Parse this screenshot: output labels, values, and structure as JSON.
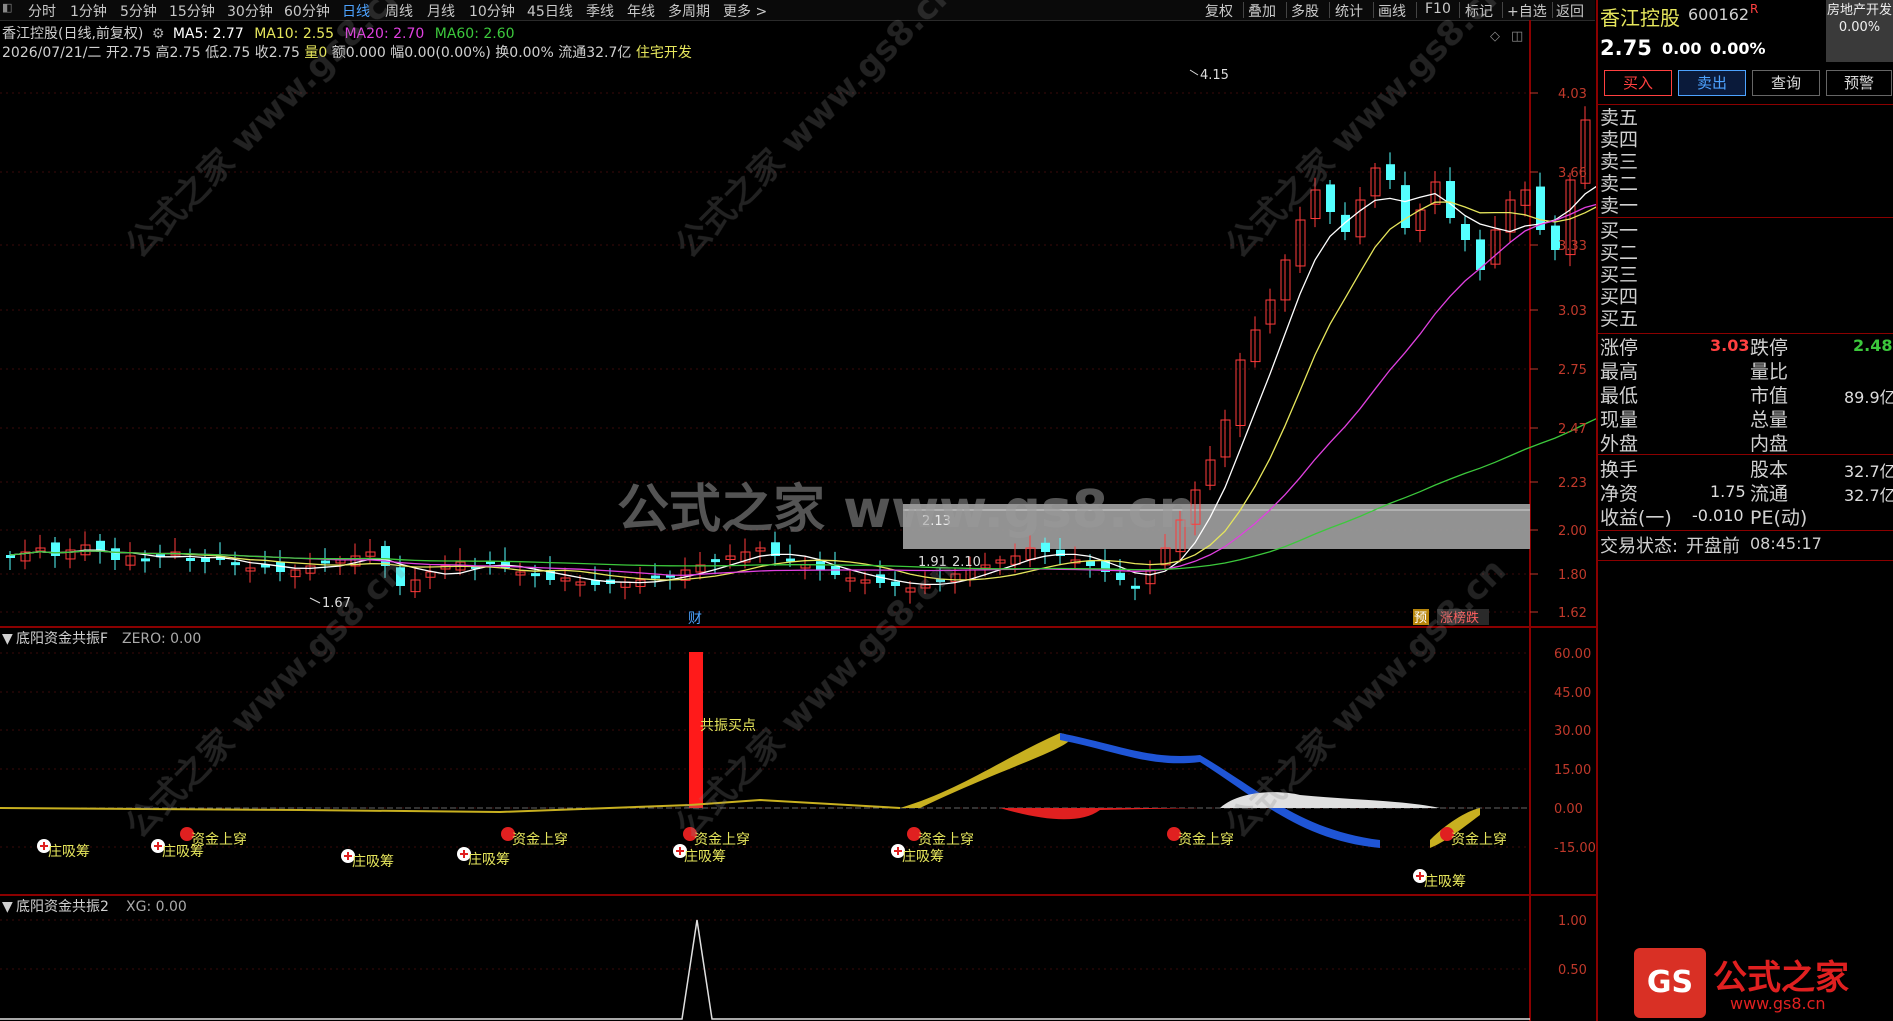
{
  "toolbar": {
    "periods": [
      "分时",
      "1分钟",
      "5分钟",
      "15分钟",
      "30分钟",
      "60分钟",
      "日线",
      "周线",
      "月线",
      "10分钟",
      "45日线",
      "季线",
      "年线",
      "多周期",
      "更多 >"
    ],
    "active": "日线",
    "right_items": [
      "复权",
      "叠加",
      "多股",
      "统计",
      "画线",
      "F10",
      "标记",
      "+自选",
      "返回"
    ]
  },
  "chart_header": {
    "title": "香江控股(日线,前复权)",
    "ma5": "MA5: 2.77",
    "ma10": "MA10: 2.55",
    "ma20": "MA20: 2.70",
    "ma60": "MA60: 2.60",
    "detail_prefix": "2026/07/21/二 开2.75 高2.75 低2.75 收2.75",
    "detail_vol": "量0",
    "detail_rest": "额0.000 幅0.00(0.00%) 换0.00% 流通32.7亿",
    "detail_sector": "住宅开发"
  },
  "colors": {
    "up": "#ff3b3b",
    "down": "#54ffff",
    "ma5": "#ffffff",
    "ma10": "#e6e65c",
    "ma20": "#e040e0",
    "ma60": "#3cc83c",
    "axis_red": "#c0392b",
    "bg": "#000000"
  },
  "main_chart": {
    "y_ticks": [
      "4.03",
      "3.66",
      "3.33",
      "3.03",
      "2.75",
      "2.47",
      "2.23",
      "2.00",
      "1.80",
      "1.62"
    ],
    "high_label": "4.15",
    "low_label": "1.67",
    "support_label": "1.91",
    "support_label2": "2.10",
    "box_label": "2.13",
    "cai_badge": "财",
    "yu_badge": "预",
    "rank_badge": "涨榜跌",
    "watermark_big": "公式之家 www.gs8.cn",
    "watermark_small": "公式之家 www.gs8.cn"
  },
  "indicator1": {
    "title": "底阳资金共振F",
    "param": "ZERO: 0.00",
    "y_ticks": [
      "60.00",
      "45.00",
      "30.00",
      "15.00",
      "0.00",
      "-15.00"
    ],
    "signal_label": "共振买点",
    "markers": [
      {
        "type": "plus",
        "label": "庄吸筹"
      },
      {
        "type": "plus",
        "label": "庄吸筹"
      },
      {
        "type": "dot",
        "label": "资金上穿"
      },
      {
        "type": "plus",
        "label": "庄吸筹"
      },
      {
        "type": "plus",
        "label": "庄吸筹"
      },
      {
        "type": "dot",
        "label": "资金上穿"
      },
      {
        "type": "plus",
        "label": "庄吸筹"
      },
      {
        "type": "dot",
        "label": "资金上穿"
      },
      {
        "type": "plus",
        "label": "庄吸筹"
      },
      {
        "type": "dot",
        "label": "资金上穿"
      },
      {
        "type": "dot",
        "label": "资金上穿"
      },
      {
        "type": "dot",
        "label": "资金上穿"
      },
      {
        "type": "plus",
        "label": "庄吸筹"
      }
    ]
  },
  "indicator2": {
    "title": "底阳资金共振2",
    "param": "XG: 0.00",
    "y_ticks": [
      "1.00",
      "0.50"
    ]
  },
  "quote_panel": {
    "name": "香江控股",
    "code": "600162",
    "flag": "R",
    "sector_badge": "房地产开发",
    "sector_pct": "0.00%",
    "price": "2.75",
    "change": "0.00",
    "pct": "0.00%",
    "buttons": [
      "买入",
      "卖出",
      "查询",
      "预警"
    ],
    "sell_levels": [
      "卖五",
      "卖四",
      "卖三",
      "卖二",
      "卖一"
    ],
    "buy_levels": [
      "买一",
      "买二",
      "买三",
      "买四",
      "买五"
    ],
    "stats_left": [
      {
        "label": "涨停",
        "value": "3.03"
      },
      {
        "label": "最高",
        "value": ""
      },
      {
        "label": "最低",
        "value": ""
      },
      {
        "label": "现量",
        "value": ""
      },
      {
        "label": "外盘",
        "value": ""
      }
    ],
    "stats_right": [
      {
        "label": "跌停",
        "value": "2.48"
      },
      {
        "label": "量比",
        "value": ""
      },
      {
        "label": "市值",
        "value": "89.9亿"
      },
      {
        "label": "总量",
        "value": ""
      },
      {
        "label": "内盘",
        "value": ""
      }
    ],
    "stats2_left": [
      {
        "label": "换手",
        "value": ""
      },
      {
        "label": "净资",
        "value": "1.75"
      },
      {
        "label": "收益(一)",
        "value": "-0.010"
      }
    ],
    "stats2_right": [
      {
        "label": "股本",
        "value": "32.7亿"
      },
      {
        "label": "流通",
        "value": "32.7亿"
      },
      {
        "label": "PE(动)",
        "value": ""
      }
    ],
    "trade_status_label": "交易状态:",
    "trade_status": "开盘前",
    "time": "08:45:17"
  },
  "logo": {
    "badge": "GS",
    "name": "公式之家",
    "url": "www.gs8.cn"
  }
}
